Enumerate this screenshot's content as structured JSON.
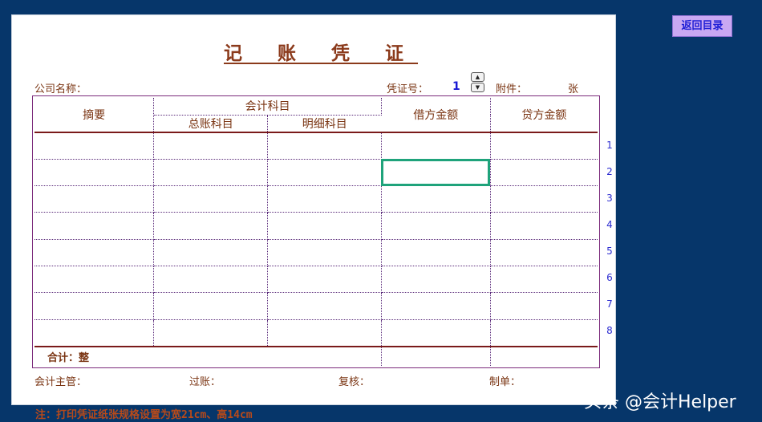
{
  "voucher": {
    "title": "记 账 凭 证",
    "company_label": "公司名称：",
    "voucher_no_label": "凭证号：",
    "voucher_no_value": "1",
    "attachments_label": "附件：",
    "attachments_unit": "张"
  },
  "table": {
    "headers": {
      "summary": "摘要",
      "account_group": "会计科目",
      "general_account": "总账科目",
      "detail_account": "明细科目",
      "debit": "借方金额",
      "credit": "贷方金额"
    },
    "row_numbers": [
      "1",
      "2",
      "3",
      "4",
      "5",
      "6",
      "7",
      "8"
    ],
    "total_label": "合计：整"
  },
  "footer": {
    "supervisor": "会计主管：",
    "posting": "过账：",
    "review": "复核：",
    "prepared": "制单："
  },
  "back_button": "返回目录",
  "note": "注：打印凭证纸张规格设置为宽21cm、高14cm",
  "watermark": "头条 @会计Helper"
}
